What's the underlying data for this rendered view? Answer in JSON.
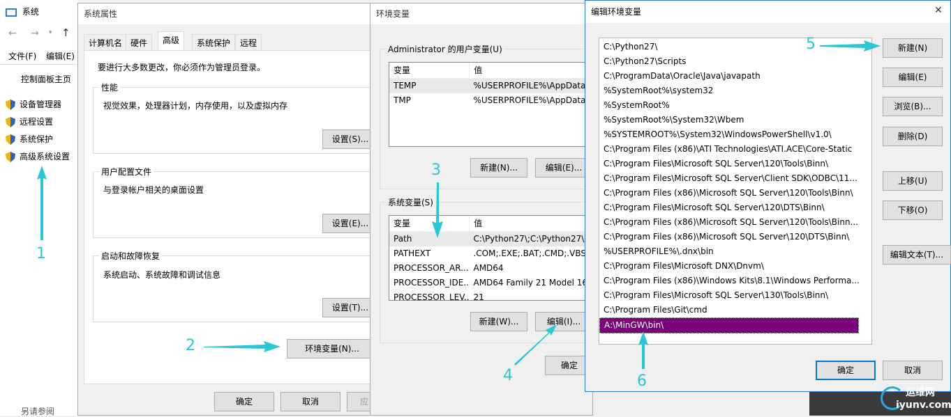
{
  "system_window": {
    "title": "系统",
    "menu": [
      "文件(F)",
      "编辑(E)"
    ],
    "control_panel_home": "控制面板主页",
    "nav_items": [
      "设备管理器",
      "远程设置",
      "系统保护",
      "高级系统设置"
    ],
    "see_also": "另请参阅"
  },
  "sysprops": {
    "title": "系统属性",
    "tabs": [
      "计算机名",
      "硬件",
      "高级",
      "系统保护",
      "远程"
    ],
    "admin_note": "要进行大多数更改，你必须作为管理员登录。",
    "performance": {
      "legend": "性能",
      "desc": "视觉效果，处理器计划，内存使用，以及虚拟内存",
      "button": "设置(S)..."
    },
    "profiles": {
      "legend": "用户配置文件",
      "desc": "与登录帐户相关的桌面设置",
      "button": "设置(E)..."
    },
    "startup": {
      "legend": "启动和故障恢复",
      "desc": "系统启动、系统故障和调试信息",
      "button": "设置(T)..."
    },
    "env_button": "环境变量(N)...",
    "ok": "确定",
    "cancel": "取消",
    "apply": "应"
  },
  "envvars": {
    "title": "环境变量",
    "user_legend": "Administrator 的用户变量(U)",
    "col_var": "变量",
    "col_val": "值",
    "user_vars": [
      {
        "name": "TEMP",
        "value": "%USERPROFILE%\\AppData\\"
      },
      {
        "name": "TMP",
        "value": "%USERPROFILE%\\AppData\\"
      }
    ],
    "user_new": "新建(N)...",
    "user_edit": "编辑(E)...",
    "system_legend": "系统变量(S)",
    "system_vars": [
      {
        "name": "Path",
        "value": "C:\\Python27\\;C:\\Python27\\S"
      },
      {
        "name": "PATHEXT",
        "value": ".COM;.EXE;.BAT;.CMD;.VBS;"
      },
      {
        "name": "PROCESSOR_AR...",
        "value": "AMD64"
      },
      {
        "name": "PROCESSOR_IDE...",
        "value": "AMD64 Family 21 Model 16"
      },
      {
        "name": "PROCESSOR_LEV...",
        "value": "21"
      }
    ],
    "system_new": "新建(W)...",
    "system_edit": "编辑(I)...",
    "ok": "确定"
  },
  "editenv": {
    "title": "编辑环境变量",
    "close": "✕",
    "entries": [
      "C:\\Python27\\",
      "C:\\Python27\\Scripts",
      "C:\\ProgramData\\Oracle\\Java\\javapath",
      "%SystemRoot%\\system32",
      "%SystemRoot%",
      "%SystemRoot%\\System32\\Wbem",
      "%SYSTEMROOT%\\System32\\WindowsPowerShell\\v1.0\\",
      "C:\\Program Files (x86)\\ATI Technologies\\ATI.ACE\\Core-Static",
      "C:\\Program Files\\Microsoft SQL Server\\120\\Tools\\Binn\\",
      "C:\\Program Files\\Microsoft SQL Server\\Client SDK\\ODBC\\11...",
      "C:\\Program Files (x86)\\Microsoft SQL Server\\120\\Tools\\Binn\\",
      "C:\\Program Files\\Microsoft SQL Server\\120\\DTS\\Binn\\",
      "C:\\Program Files (x86)\\Microsoft SQL Server\\120\\Tools\\Binn...",
      "C:\\Program Files (x86)\\Microsoft SQL Server\\120\\DTS\\Binn\\",
      "%USERPROFILE%\\.dnx\\bin",
      "C:\\Program Files\\Microsoft DNX\\Dnvm\\",
      "C:\\Program Files (x86)\\Windows Kits\\8.1\\Windows Performa...",
      "C:\\Program Files\\Microsoft SQL Server\\130\\Tools\\Binn\\",
      "C:\\Program Files\\Git\\cmd",
      "A:\\MinGW\\bin\\"
    ],
    "buttons": {
      "new": "新建(N)",
      "edit": "编辑(E)",
      "browse": "浏览(B)...",
      "delete": "删除(D)",
      "up": "上移(U)",
      "down": "下移(O)",
      "edit_text": "编辑文本(T)..."
    },
    "ok": "确定",
    "cancel": "取消"
  },
  "annotations": [
    "1",
    "2",
    "3",
    "4",
    "5",
    "6"
  ],
  "watermark": {
    "text": "运维网",
    "url": "iyunv.com"
  },
  "colors": {
    "selection": "#7a007a",
    "annotation": "#29c6d6",
    "primary_border": "#0078d7"
  }
}
